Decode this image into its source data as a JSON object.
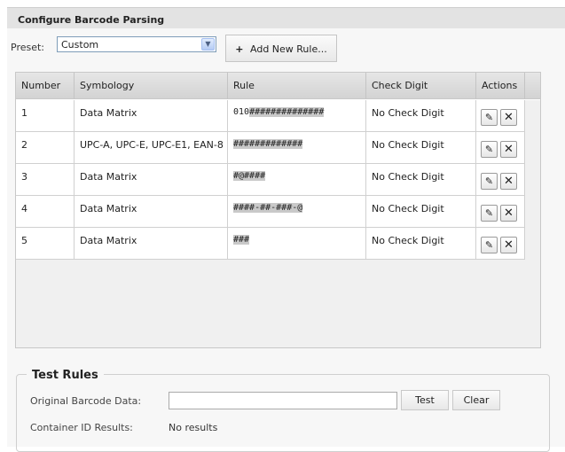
{
  "panel": {
    "title": "Configure Barcode Parsing"
  },
  "preset": {
    "label": "Preset:",
    "value": "Custom"
  },
  "add_rule_button": {
    "label": "Add New Rule...",
    "icon": "plus-icon"
  },
  "grid": {
    "columns": [
      "Number",
      "Symbology",
      "Rule",
      "Check Digit",
      "Actions"
    ],
    "rows": [
      {
        "number": "1",
        "symbology": "Data Matrix",
        "rule_prefix": "010",
        "rule_masked": "##############",
        "check_digit": "No Check Digit"
      },
      {
        "number": "2",
        "symbology": "UPC-A, UPC-E, UPC-E1, EAN-8",
        "rule_prefix": "",
        "rule_masked": "#############",
        "check_digit": "No Check Digit"
      },
      {
        "number": "3",
        "symbology": "Data Matrix",
        "rule_prefix": "",
        "rule_masked": "#@####",
        "check_digit": "No Check Digit"
      },
      {
        "number": "4",
        "symbology": "Data Matrix",
        "rule_prefix": "",
        "rule_masked": "####-##-###-@",
        "check_digit": "No Check Digit"
      },
      {
        "number": "5",
        "symbology": "Data Matrix",
        "rule_prefix": "",
        "rule_masked": "###",
        "check_digit": "No Check Digit"
      }
    ],
    "edit_icon": "pencil-icon",
    "delete_icon": "close-x-icon"
  },
  "test_rules": {
    "legend": "Test Rules",
    "original_label": "Original Barcode Data:",
    "original_value": "",
    "test_button": "Test",
    "clear_button": "Clear",
    "results_label": "Container ID Results:",
    "results_value": "No results"
  }
}
